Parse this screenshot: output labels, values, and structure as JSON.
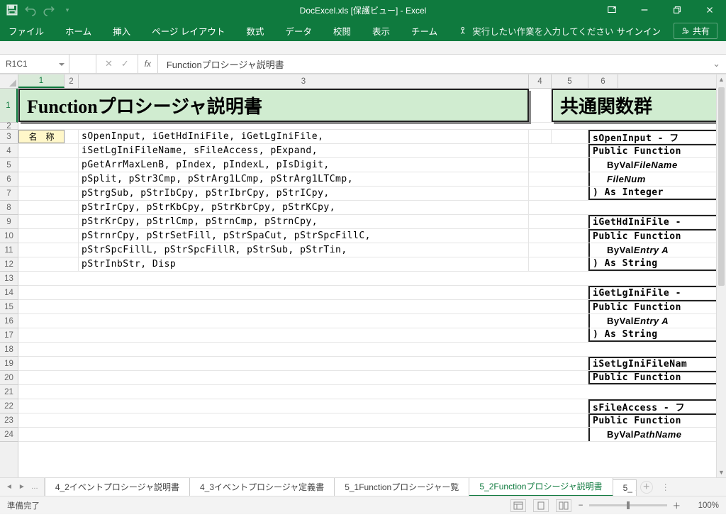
{
  "window": {
    "title": "DocExcel.xls  [保護ビュー]  -  Excel"
  },
  "ribbon": {
    "tabs": [
      "ファイル",
      "ホーム",
      "挿入",
      "ページ レイアウト",
      "数式",
      "データ",
      "校閲",
      "表示",
      "チーム"
    ],
    "tell_me": "実行したい作業を入力してください",
    "sign_in": "サインイン",
    "share": "共有"
  },
  "namebox": {
    "ref": "R1C1"
  },
  "formula": {
    "value": "Functionプロシージャ説明書"
  },
  "columns": {
    "c1": "1",
    "c2": "2",
    "c3": "3",
    "c4": "4",
    "c5": "5",
    "c6": "6"
  },
  "row_labels": [
    "1",
    "2",
    "3",
    "4",
    "5",
    "6",
    "7",
    "8",
    "9",
    "10",
    "11",
    "12",
    "13",
    "14",
    "15",
    "16",
    "17",
    "18",
    "19",
    "20",
    "21",
    "22",
    "23",
    "24"
  ],
  "sheet": {
    "title": "Functionプロシージャ説明書",
    "title_right": "共通関数群",
    "label_name": "名　称",
    "lines": [
      "sOpenInput, iGetHdIniFile, iGetLgIniFile,",
      "iSetLgIniFileName, sFileAccess, pExpand,",
      "pGetArrMaxLenB, pIndex, pIndexL, pIsDigit,",
      "pSplit, pStr3Cmp, pStrArg1LCmp, pStrArg1LTCmp,",
      "pStrgSub, pStrIbCpy, pStrIbrCpy, pStrICpy,",
      "pStrIrCpy, pStrKbCpy, pStrKbrCpy, pStrKCpy,",
      "pStrKrCpy, pStrlCmp, pStrnCmp, pStrnCpy,",
      "pStrnrCpy, pStrSetFill, pStrSpaCut, pStrSpcFillC,",
      "pStrSpcFillL, pStrSpcFillR, pStrSub, pStrTin,",
      "pStrInbStr, Disp"
    ],
    "side": {
      "g1": {
        "h": "sOpenInput  -  フ",
        "pf": "Public Function",
        "bv1": "ByVal ",
        "bv1i": "FileName",
        "bv2i": "FileNum",
        "ret": ") As Integer"
      },
      "g2": {
        "h": "iGetHdIniFile  -",
        "pf": "Public Function",
        "bv1": "ByVal ",
        "bv1i": "Entry   A",
        "ret": ") As String"
      },
      "g3": {
        "h": "iGetLgIniFile  -",
        "pf": "Public Function",
        "bv1": "ByVal ",
        "bv1i": "Entry   A",
        "ret": ") As String"
      },
      "g4": {
        "h": "iSetLgIniFileNam",
        "pf": "Public Function"
      },
      "g5": {
        "h": "sFileAccess  -  フ",
        "pf": "Public Function",
        "bv1": "ByVal ",
        "bv1i": "PathName"
      }
    }
  },
  "tabs": {
    "ellipsis": "…",
    "t1": "4_2イベントプロシージャ説明書",
    "t2": "4_3イベントプロシージャ定義書",
    "t3": "5_1Functionプロシージャー覧",
    "t4": "5_2Functionプロシージャ説明書",
    "t5": "5_ …"
  },
  "status": {
    "ready": "準備完了",
    "zoom": "100%"
  },
  "colwidths": {
    "c1": 65,
    "c2": 20,
    "c3": 635,
    "c4": 32,
    "c5": 52,
    "c6": 42,
    "rest": 200
  }
}
